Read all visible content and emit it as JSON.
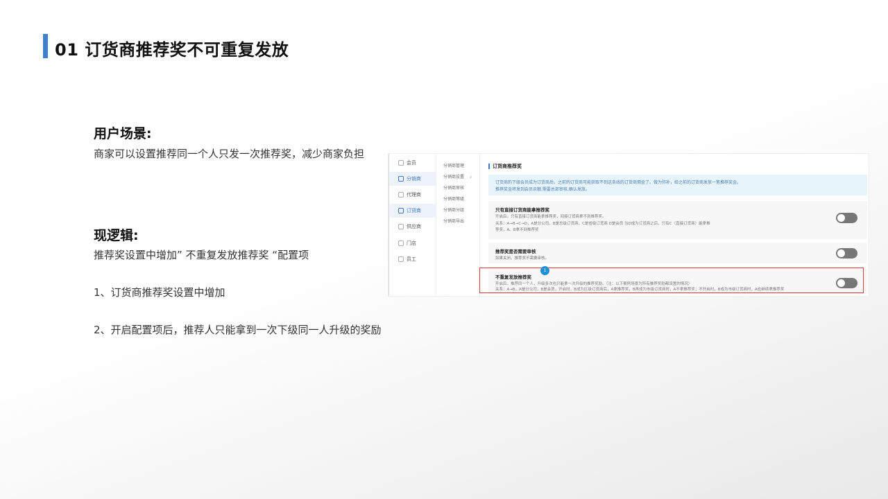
{
  "slide": {
    "title": "01 订货商推荐奖不可重复发放"
  },
  "scenario": {
    "heading": "用户场景:",
    "text": "商家可以设置推荐同一个人只发一次推荐奖，减少商家负担"
  },
  "logic": {
    "heading": "现逻辑:",
    "text": "推荐奖设置中增加” 不重复发放推荐奖 “配置项",
    "point1": "1、订货商推荐奖设置中增加",
    "point2": "2、开启配置项后，推荐人只能拿到一次下级同一人升级的奖励"
  },
  "screenshot": {
    "nav_primary": [
      {
        "label": "会员",
        "icon": "user-icon",
        "active": false
      },
      {
        "label": "分销商",
        "icon": "distributor-icon",
        "active": true
      },
      {
        "label": "代理商",
        "icon": "agent-icon",
        "active": false
      },
      {
        "label": "订货商",
        "icon": "order-icon",
        "active": true
      },
      {
        "label": "供应商",
        "icon": "supplier-icon",
        "active": false
      },
      {
        "label": "门店",
        "icon": "store-icon",
        "active": false
      },
      {
        "label": "员工",
        "icon": "staff-icon",
        "active": false
      }
    ],
    "nav_secondary": [
      "分销商管理",
      "分销商设置",
      "分销商审核",
      "分销商等级",
      "分销商分组",
      "分销商导出"
    ],
    "section_title": "订货商推荐奖",
    "notice": [
      "订货商的下级会员成为订货商后，之前的订货商可能获取不到这条线的订货商佣金了。做为弥补，给之前的订货商发放一笔推荐奖金。",
      "推荐奖金将发到会员余额,需要总部审核,确认发放。"
    ],
    "cards": [
      {
        "title": "只有直接订货商能拿推荐奖",
        "desc": [
          "开启后，只有直接订货商能拿推荐奖，间接订货商拿不到推荐奖。",
          "关系：A→B→C→D，A是分公司，B是总级订货商，C是省级订货商 D是会员 当D成为订货商之后，只有C（直接订货商）能拿推",
          "荐奖，A、B拿不到推荐奖"
        ]
      },
      {
        "title": "推荐奖是否需要审核",
        "desc": [
          "如果关闭，推荐奖不需要审核。"
        ]
      },
      {
        "title": "不重复发放推荐奖",
        "desc": [
          "开启后，推荐同一个人，升级多次也只能拿一次升级的推荐奖励。（注：以下案例场景为所有推荐奖励都设置的情况）",
          "关系：A→B，A是分公司，B是会员，开启时，B成为区级订货商后，A拿推荐奖，B再成为市级订货商时，A不拿推荐奖；不开启时，B成为市级订货商时，A也继续拿推荐奖"
        ]
      }
    ],
    "badge": "1",
    "colors": {
      "accent": "#3b78c8",
      "highlight": "#e0383e",
      "toggle_off": "#777777",
      "notice_bg": "#e8f4fc"
    }
  }
}
